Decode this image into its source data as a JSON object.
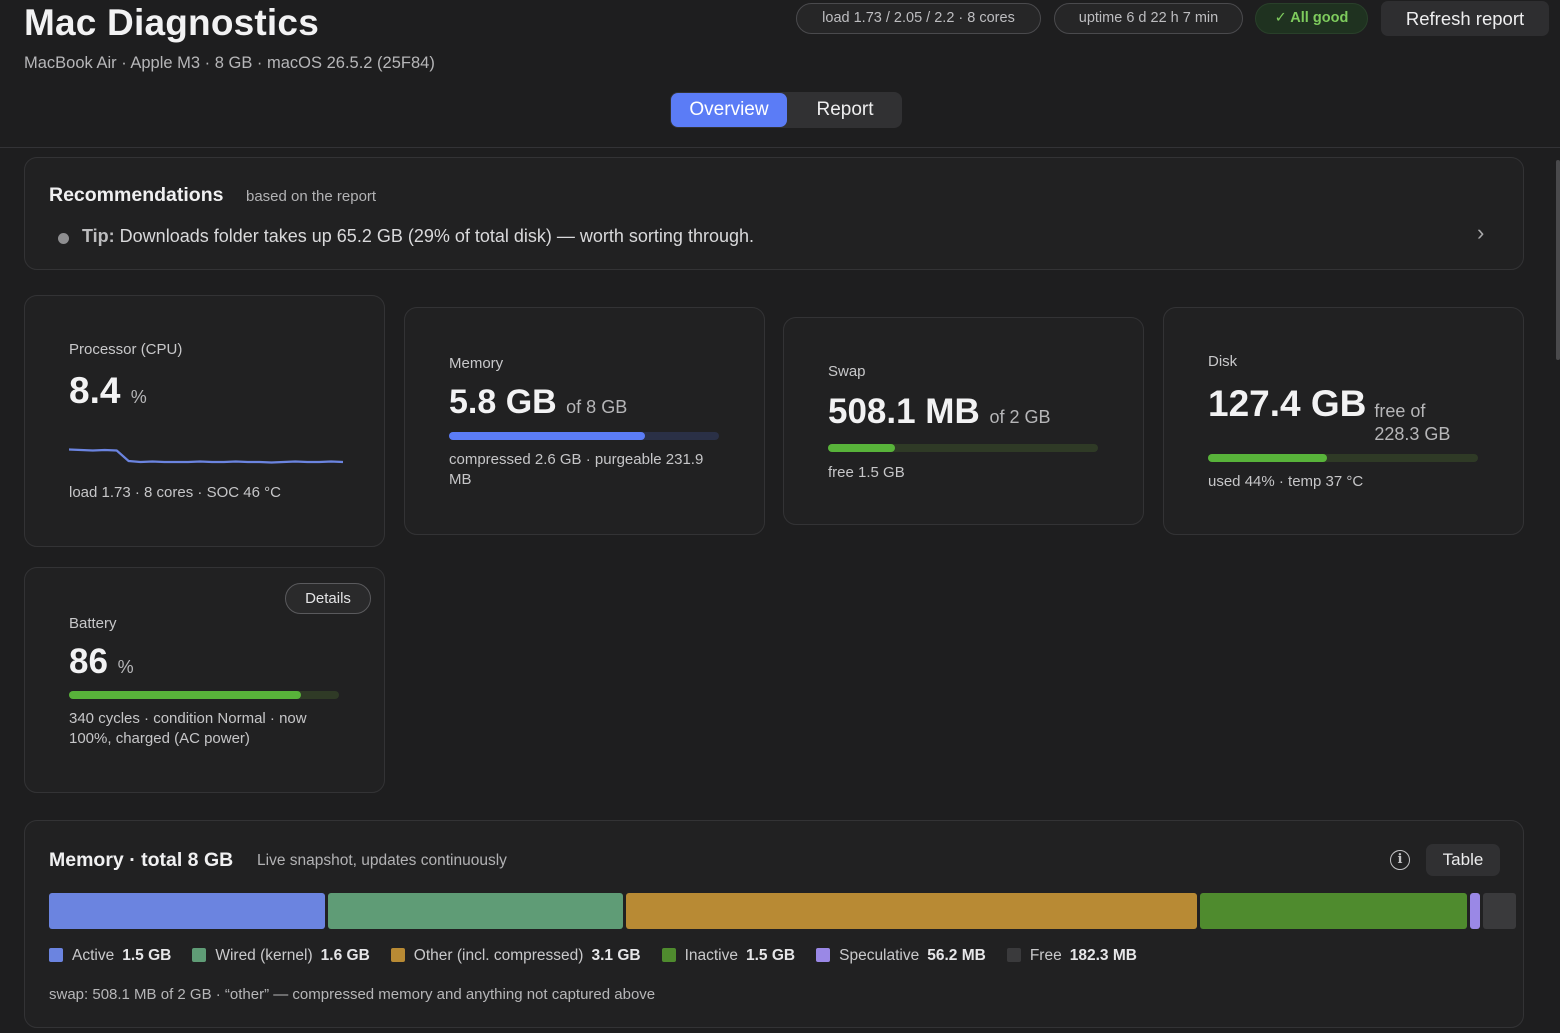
{
  "header": {
    "title": "Mac Diagnostics",
    "subtitle": "MacBook Air · Apple M3 · 8 GB · macOS 26.5.2 (25F84)",
    "load_pill": "load 1.73 / 2.05 / 2.2 · 8 cores",
    "uptime_pill": "uptime 6 d 22 h 7 min",
    "status_pill": "✓ All good",
    "refresh_label": "Refresh report",
    "tabs": [
      {
        "label": "Overview",
        "active": true
      },
      {
        "label": "Report",
        "active": false
      }
    ]
  },
  "recommendations": {
    "title": "Recommendations",
    "subtitle": "based on the report",
    "tip_prefix": "Tip:",
    "tip_text": " Downloads folder takes up 65.2 GB (29% of total disk) — worth sorting through."
  },
  "cpu": {
    "label": "Processor (CPU)",
    "value": "8.4",
    "unit": "%",
    "footer": "load 1.73 · 8 cores · SOC 46 °C",
    "sparkline": [
      10.5,
      10.4,
      10.3,
      10.4,
      10.3,
      8.2,
      8.0,
      8.1,
      8.0,
      8.0,
      8.0,
      8.1,
      8.0,
      8.0,
      8.1,
      8.0,
      8.0,
      7.9,
      8.0,
      8.1,
      8.0,
      8.0,
      8.1,
      8.0
    ]
  },
  "memory": {
    "label": "Memory",
    "value": "5.8 GB",
    "of": "of 8 GB",
    "fraction": 0.725,
    "color": "#5b7cf6",
    "footer": "compressed 2.6 GB · purgeable 231.9 MB"
  },
  "swap": {
    "label": "Swap",
    "value": "508.1 MB",
    "of": "of 2 GB",
    "fraction": 0.248,
    "color": "#58b33a",
    "footer": "free 1.5 GB"
  },
  "disk": {
    "label": "Disk",
    "value": "127.4 GB",
    "of": "free of 228.3 GB",
    "fraction": 0.44,
    "color": "#58b33a",
    "footer": "used 44% · temp 37 °C"
  },
  "battery": {
    "label": "Battery",
    "value": "86",
    "unit": "%",
    "fraction": 0.86,
    "color": "#58b33a",
    "details_label": "Details",
    "footer": "340 cycles · condition Normal · now 100%, charged (AC power)"
  },
  "memory_breakdown": {
    "title": "Memory · total 8 GB",
    "subtitle": "Live snapshot, updates continuously",
    "table_label": "Table",
    "footer": "swap: 508.1 MB of 2 GB · “other” — compressed memory and anything not captured above",
    "segments": [
      {
        "name": "Active",
        "value": "1.5 GB",
        "gb": 1.5,
        "color": "#6b84e0"
      },
      {
        "name": "Wired (kernel)",
        "value": "1.6 GB",
        "gb": 1.6,
        "color": "#5f9c76"
      },
      {
        "name": "Other (incl. compressed)",
        "value": "3.1 GB",
        "gb": 3.1,
        "color": "#b88a34"
      },
      {
        "name": "Inactive",
        "value": "1.5 GB",
        "gb": 1.45,
        "color": "#4f8b2e"
      },
      {
        "name": "Speculative",
        "value": "56.2 MB",
        "gb": 0.055,
        "color": "#9a88e6"
      },
      {
        "name": "Free",
        "value": "182.3 MB",
        "gb": 0.178,
        "color": "#3a3a3c"
      }
    ]
  }
}
